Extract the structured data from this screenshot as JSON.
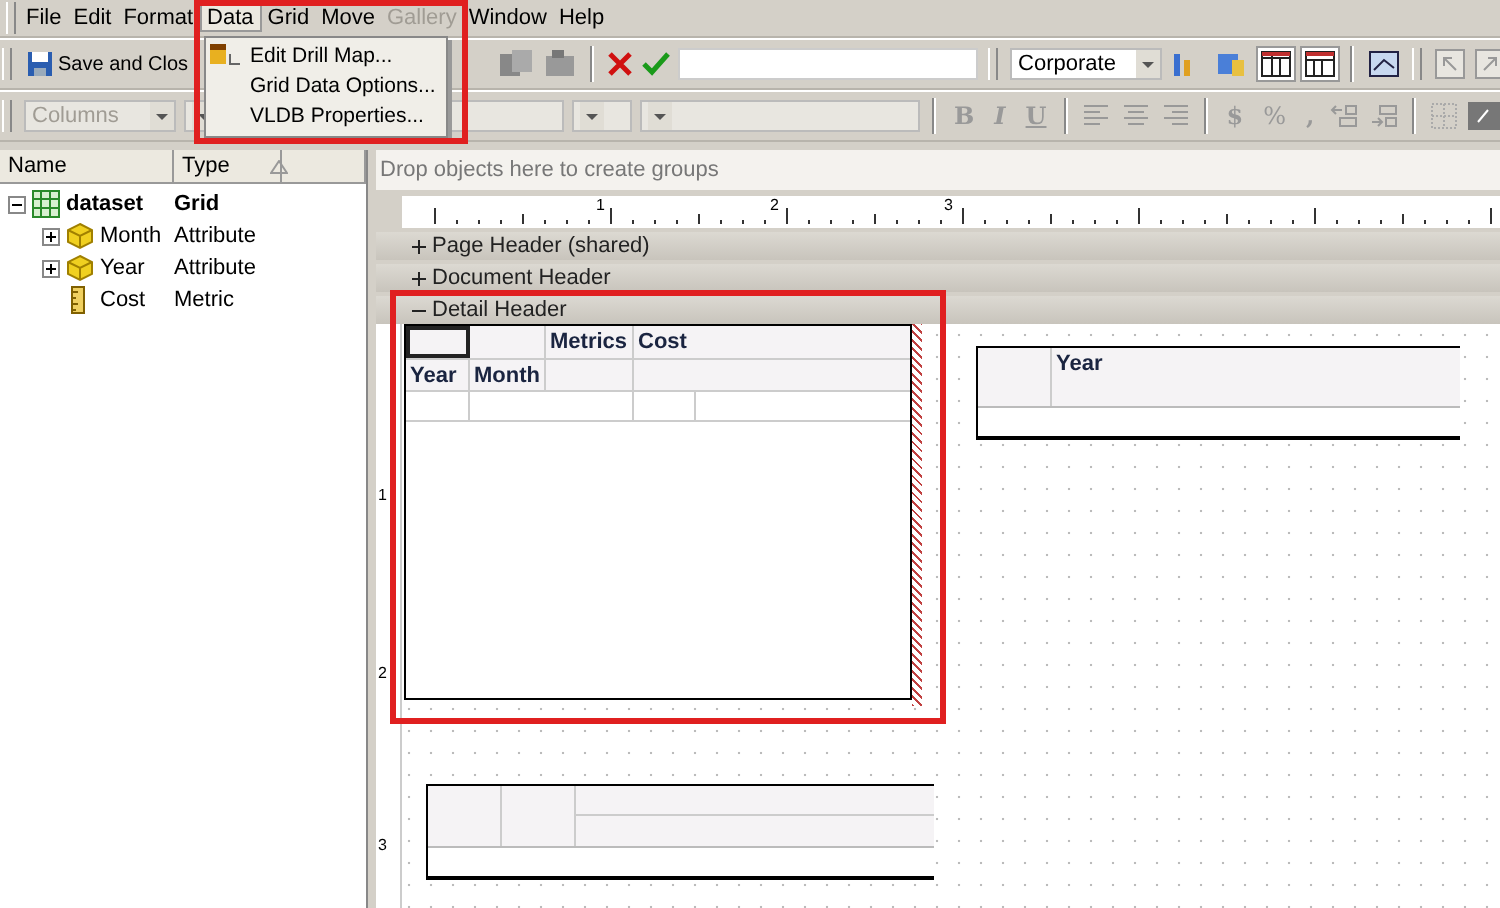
{
  "menu_bar": [
    {
      "label": "File",
      "selected": false,
      "disabled": false
    },
    {
      "label": "Edit",
      "selected": false,
      "disabled": false
    },
    {
      "label": "Format",
      "selected": false,
      "disabled": false
    },
    {
      "label": "Data",
      "selected": true,
      "disabled": false
    },
    {
      "label": "Grid",
      "selected": false,
      "disabled": false
    },
    {
      "label": "Move",
      "selected": false,
      "disabled": false
    },
    {
      "label": "Gallery",
      "selected": false,
      "disabled": true
    },
    {
      "label": "Window",
      "selected": false,
      "disabled": false
    },
    {
      "label": "Help",
      "selected": false,
      "disabled": false
    }
  ],
  "open_menu": {
    "items": [
      {
        "label": "Edit Drill Map...",
        "kind": "drill"
      },
      {
        "label": "Grid Data Options...",
        "kind": "plain"
      },
      {
        "label": "VLDB Properties...",
        "kind": "plain"
      }
    ]
  },
  "toolbar": {
    "save_button": "Save and Clos",
    "style_select": "Corporate"
  },
  "format_toolbar": {
    "columns_select": "Columns",
    "bold": "B",
    "italic": "I",
    "underline": "U",
    "currency": "$",
    "percent": "%",
    "comma": ","
  },
  "dataset_panel": {
    "columns": [
      "Name",
      "Type"
    ],
    "rows": [
      {
        "name": "dataset",
        "type": "Grid",
        "kind": "grid",
        "expanded": true,
        "children": [
          {
            "name": "Month",
            "type": "Attribute",
            "kind": "attribute",
            "expanded": false
          },
          {
            "name": "Year",
            "type": "Attribute",
            "kind": "attribute",
            "expanded": false
          },
          {
            "name": "Cost",
            "type": "Metric",
            "kind": "metric"
          }
        ]
      }
    ]
  },
  "group_drop_hint": "Drop objects here to create groups",
  "ruler_marks": [
    "1",
    "2",
    "3"
  ],
  "vertical_ruler_marks": [
    "1",
    "2",
    "3"
  ],
  "sections": [
    {
      "label": "Page Header (shared)",
      "expanded": false
    },
    {
      "label": "Document Header",
      "expanded": false
    },
    {
      "label": "Detail Header",
      "expanded": true
    }
  ],
  "grid": {
    "column_headers": [
      "Metrics",
      "Cost"
    ],
    "row_headers": [
      "Year",
      "Month"
    ]
  },
  "second_grid": {
    "header": "Year"
  }
}
